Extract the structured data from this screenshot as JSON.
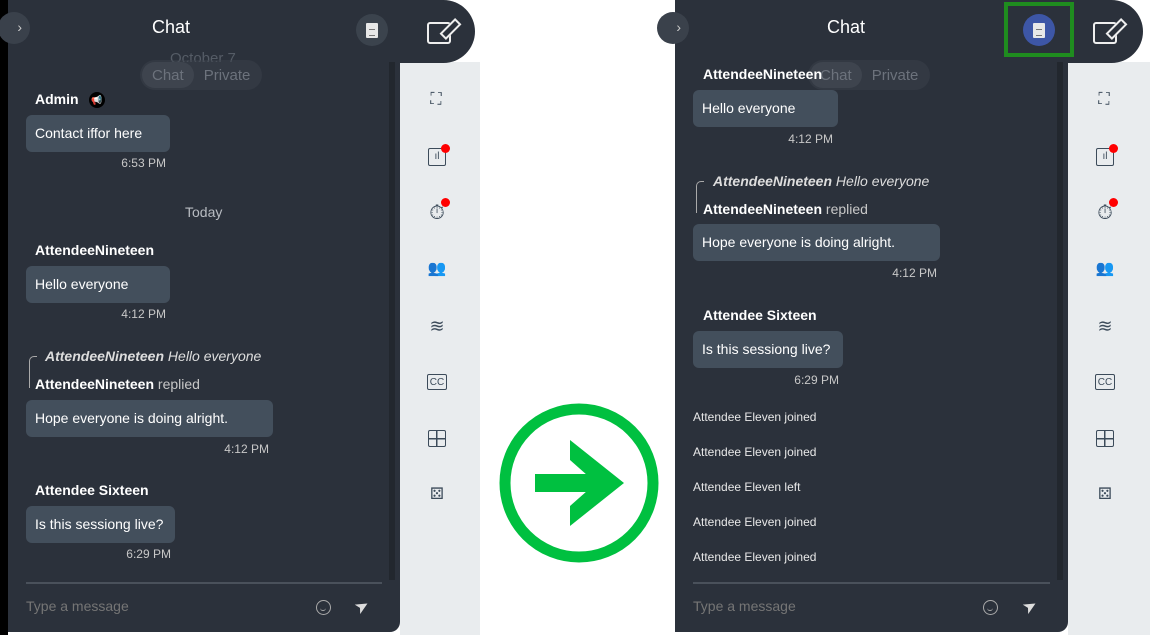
{
  "before": {
    "header": {
      "title": "Chat",
      "transcript_icon": "document-icon",
      "collapse_icon": "chevron-right-icon",
      "compose_icon": "edit-icon"
    },
    "tabs": [
      "Chat",
      "Private"
    ],
    "faded_date": "October 7",
    "messages": [
      {
        "sender": "Admin",
        "badge_icon": "megaphone-icon",
        "text": "Contact iffor here",
        "time": "6:53 PM"
      },
      {
        "sender": "AttendeeNineteen",
        "text": "Hello everyone",
        "time": "4:12 PM"
      },
      {
        "reply_to_sender": "AttendeeNineteen",
        "reply_to_text": "Hello everyone",
        "sender": "AttendeeNineteen",
        "replied_label": "replied",
        "text": "Hope everyone is doing alright.",
        "time": "4:12 PM"
      },
      {
        "sender": "Attendee Sixteen",
        "text": "Is this sessiong live?",
        "time": "6:29 PM"
      }
    ],
    "day_divider": "Today",
    "input_placeholder": "Type a message"
  },
  "after": {
    "header": {
      "title": "Chat",
      "transcript_icon": "document-icon",
      "transcript_active": true,
      "highlight_color": "#1f8c1f"
    },
    "tabs": [
      "Chat",
      "Private"
    ],
    "messages": [
      {
        "sender": "AttendeeNineteen",
        "text": "Hello everyone",
        "time": "4:12 PM"
      },
      {
        "reply_to_sender": "AttendeeNineteen",
        "reply_to_text": "Hello everyone",
        "sender": "AttendeeNineteen",
        "replied_label": "replied",
        "text": "Hope everyone is doing alright.",
        "time": "4:12 PM"
      },
      {
        "sender": "Attendee Sixteen",
        "text": "Is this sessiong live?",
        "time": "6:29 PM"
      }
    ],
    "system_events": [
      "Attendee Eleven joined",
      "Attendee Eleven joined",
      "Attendee Eleven left",
      "Attendee Eleven joined",
      "Attendee Eleven joined"
    ],
    "input_placeholder": "Type a message"
  },
  "sidebar_icons": [
    "presenter-icon",
    "poll-icon",
    "timer-icon",
    "people-icon",
    "layers-icon",
    "closed-captions-icon",
    "grid-icon",
    "dice-icon"
  ],
  "notification_color": "#ff0000",
  "arrow_color": "#00c040",
  "arrow_icon": "arrow-right-icon"
}
